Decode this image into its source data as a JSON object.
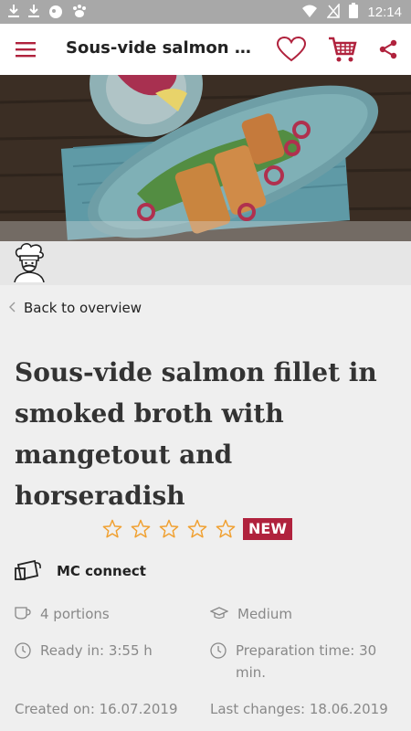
{
  "status_bar": {
    "left_icons": [
      "download-icon",
      "download-icon",
      "app-icon",
      "paw-icon"
    ],
    "time": "12:14"
  },
  "app_bar": {
    "title": "Sous-vide salmon fille...",
    "menu_icon": "hamburger-menu-icon",
    "favorite_icon": "heart-icon",
    "cart_icon": "shopping-cart-icon",
    "share_icon": "share-icon"
  },
  "hero": {
    "avatar_icon": "chef-avatar-icon"
  },
  "back_link": {
    "label": "Back to overview"
  },
  "recipe": {
    "title": "Sous-vide salmon fillet in smoked broth with mangetout and horseradish",
    "rating_max": 5,
    "rating": 0,
    "badge": "NEW",
    "device_label": "MC connect",
    "portions": "4 portions",
    "difficulty": "Medium",
    "ready_in": "Ready in: 3:55 h",
    "prep_time": "Preparation time: 30 min.",
    "created_on": "Created on: 16.07.2019",
    "last_changes": "Last changes: 18.06.2019"
  },
  "colors": {
    "accent": "#b0223d",
    "star": "#f0a030",
    "status_bar": "#a8a8a8"
  }
}
